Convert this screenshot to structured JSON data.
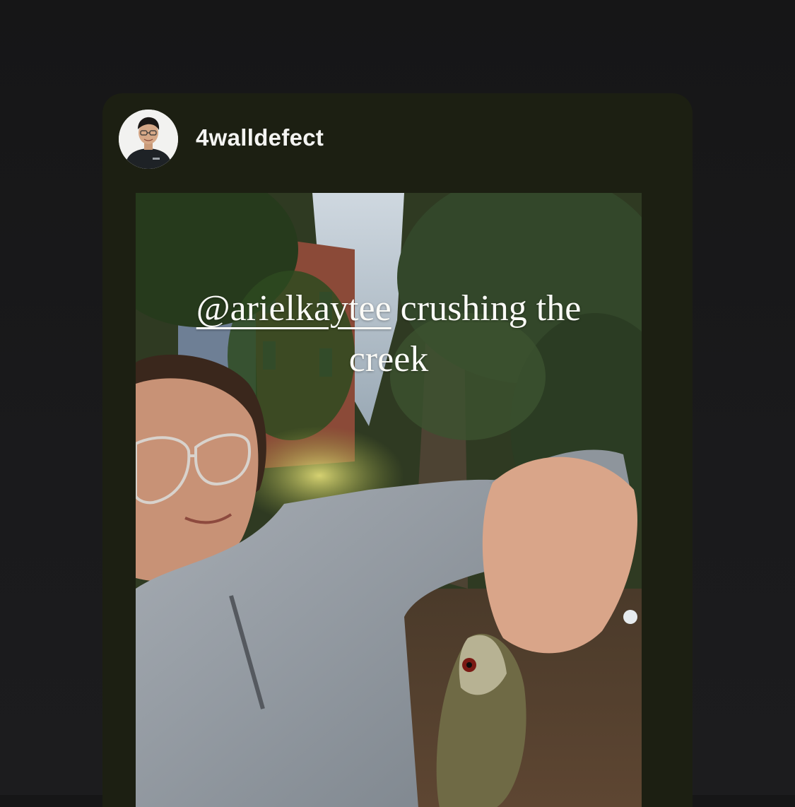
{
  "post": {
    "username": "4walldefect"
  },
  "story": {
    "caption_mention": "@arielkaytee",
    "caption_text_line1": " crushing the",
    "caption_text_line2": "creek"
  },
  "icons": {
    "avatar": "user-avatar"
  },
  "colors": {
    "page_background": "#161617",
    "card_background": "#1c1f12",
    "username_text": "#f4f4f2",
    "caption_text": "#fbfbf7"
  }
}
